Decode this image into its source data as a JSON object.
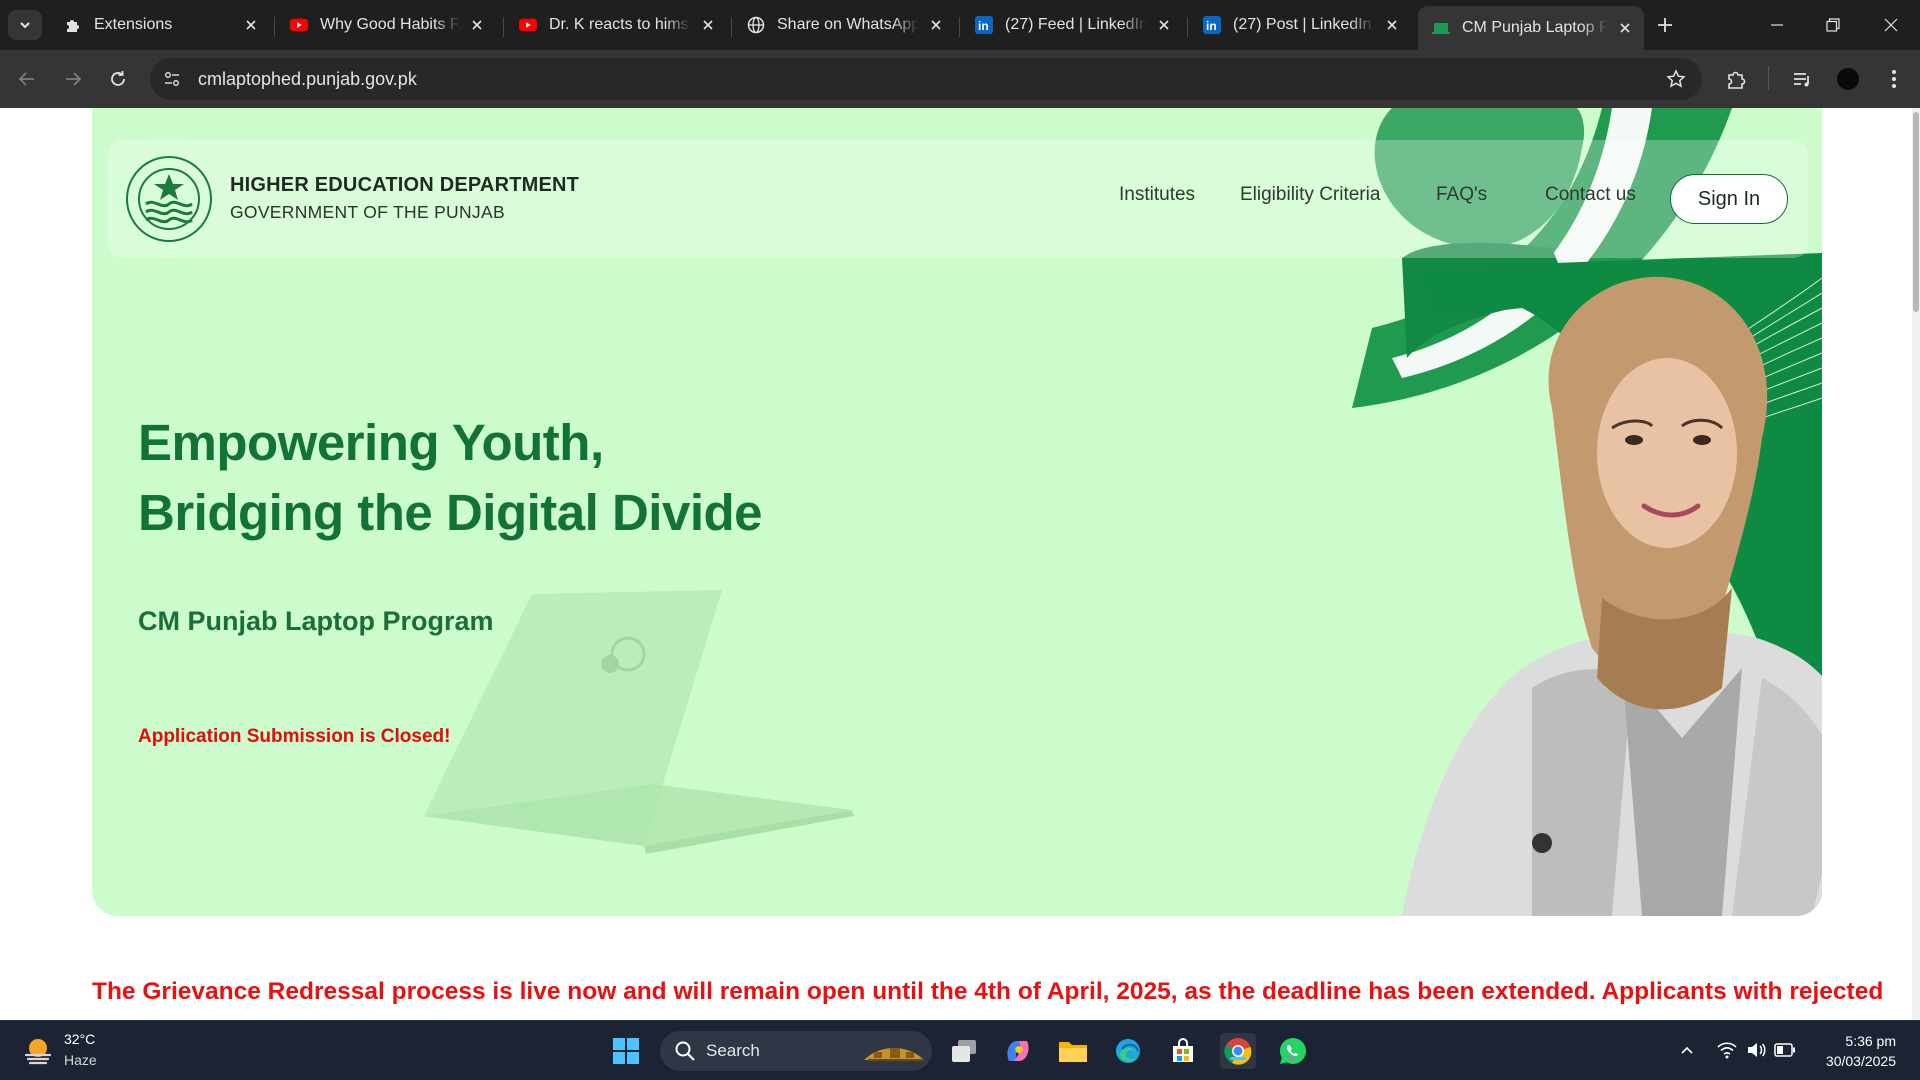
{
  "browser": {
    "tabs": [
      {
        "title": "Extensions",
        "icon": "puzzle-icon",
        "active": false
      },
      {
        "title": "Why Good Habits Ra",
        "icon": "youtube-icon",
        "active": false
      },
      {
        "title": "Dr. K reacts to himsel",
        "icon": "youtube-icon",
        "active": false
      },
      {
        "title": "Share on WhatsApp",
        "icon": "globe-icon",
        "active": false
      },
      {
        "title": "(27) Feed | LinkedIn",
        "icon": "linkedin-icon",
        "active": false
      },
      {
        "title": "(27) Post | LinkedIn",
        "icon": "linkedin-icon",
        "active": false
      },
      {
        "title": "CM Punjab Laptop Pr",
        "icon": "site-favicon-icon",
        "active": true
      }
    ],
    "url": "cmlaptophed.punjab.gov.pk"
  },
  "page": {
    "header": {
      "department": "HIGHER EDUCATION DEPARTMENT",
      "government": "GOVERNMENT OF THE PUNJAB",
      "nav": [
        "Institutes",
        "Eligibility Criteria",
        "FAQ's",
        "Contact us"
      ],
      "signin": "Sign In"
    },
    "hero": {
      "headline_line1": "Empowering Youth,",
      "headline_line2": "Bridging the Digital Divide",
      "program": "CM Punjab Laptop Program",
      "status": "Application Submission is Closed!"
    },
    "notice": "The Grievance Redressal process is live now and will remain open until the 4th of April, 2025, as the deadline has been extended. Applicants with rejected"
  },
  "taskbar": {
    "weather": {
      "temp": "32°C",
      "condition": "Haze"
    },
    "search_label": "Search",
    "apps": [
      "task-view-icon",
      "copilot-icon",
      "file-explorer-icon",
      "edge-icon",
      "store-icon",
      "chrome-icon",
      "whatsapp-icon"
    ],
    "time": "5:36 pm",
    "date": "30/03/2025"
  },
  "colors": {
    "hero_bg": "#ccfccb",
    "brand_green": "#127238",
    "alert_red": "#e30b0b",
    "taskbar_bg": "#1c2433"
  }
}
